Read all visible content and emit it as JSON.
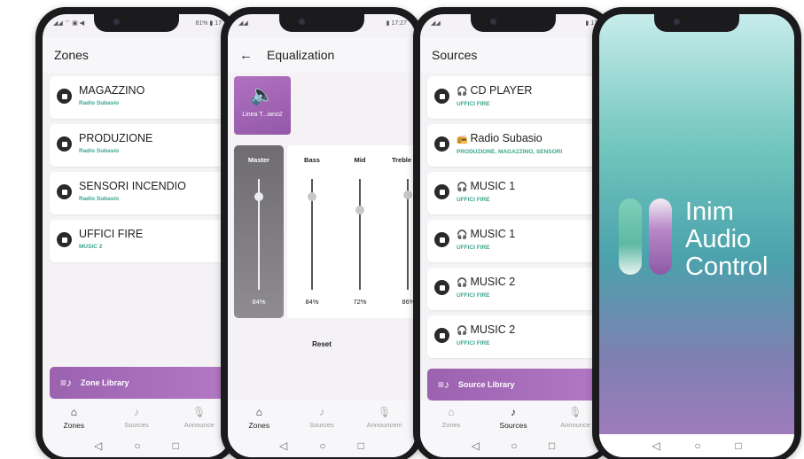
{
  "colors": {
    "accent_purple": "#9b62b0",
    "sub_teal": "#3aa58d",
    "phone_frame": "#1b1b1d"
  },
  "phone1": {
    "status_left": "◢◢ ⌔ ▣ ◀",
    "status_right": "81% ▮ 17",
    "title": "Zones",
    "zones": [
      {
        "name": "MAGAZZINO",
        "source": "Radio Subasio"
      },
      {
        "name": "PRODUZIONE",
        "source": "Radio Subasio"
      },
      {
        "name": "SENSORI INCENDIO",
        "source": "Radio Subasio"
      },
      {
        "name": "UFFICI FIRE",
        "source": "MUSIC 2"
      }
    ],
    "library_label": "Zone Library",
    "nav": [
      "Zones",
      "Sources",
      "Announce"
    ]
  },
  "phone2": {
    "status_left": "◢◢",
    "status_right": "▮ 17:27",
    "back_icon": "←",
    "title": "Equalization",
    "device_label": "Linea T...iano2",
    "bands": [
      {
        "name": "Master",
        "value": "84%",
        "level": 84
      },
      {
        "name": "Bass",
        "value": "84%",
        "level": 84
      },
      {
        "name": "Mid",
        "value": "72%",
        "level": 72
      },
      {
        "name": "Treble",
        "value": "86%",
        "level": 86
      }
    ],
    "reset_label": "Reset",
    "nav": [
      "Zones",
      "Sources",
      "Announcem"
    ]
  },
  "phone3": {
    "status_left": "◢◢",
    "status_right": "▮ 17",
    "title": "Sources",
    "sources": [
      {
        "icon": "headphones-icon",
        "name": "CD PLAYER",
        "zones": "UFFICI FIRE"
      },
      {
        "icon": "radio-icon",
        "name": "Radio Subasio",
        "zones": "PRODUZIONE, MAGAZZINO, SENSORI"
      },
      {
        "icon": "headphones-icon",
        "name": "MUSIC 1",
        "zones": "UFFICI FIRE"
      },
      {
        "icon": "headphones-icon",
        "name": "MUSIC 1",
        "zones": "UFFICI FIRE"
      },
      {
        "icon": "headphones-icon",
        "name": "MUSIC 2",
        "zones": "UFFICI FIRE"
      },
      {
        "icon": "headphones-icon",
        "name": "MUSIC 2",
        "zones": "UFFICI FIRE"
      }
    ],
    "library_label": "Source Library",
    "nav": [
      "Zones",
      "Sources",
      "Announce"
    ]
  },
  "phone4": {
    "line1": "Inim",
    "line2": "Audio",
    "line3": "Control"
  }
}
